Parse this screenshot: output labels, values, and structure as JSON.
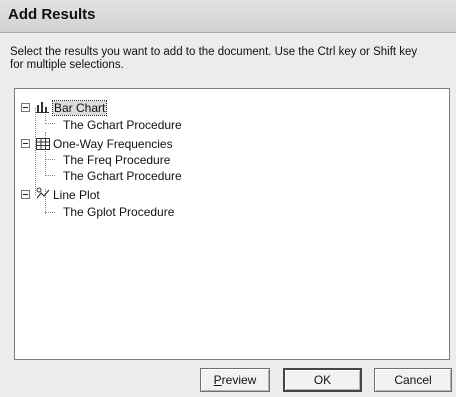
{
  "dialog": {
    "title": "Add Results",
    "instructions": "Select the results you want to add to the document.  Use the Ctrl key or Shift key\nfor multiple selections."
  },
  "tree": {
    "nodes": [
      {
        "label": "Bar Chart",
        "icon": "bar-chart-icon",
        "expanded": true,
        "selected": true,
        "children": [
          "The Gchart Procedure"
        ]
      },
      {
        "label": "One-Way Frequencies",
        "icon": "table-icon",
        "expanded": true,
        "selected": false,
        "children": [
          "The Freq Procedure",
          "The Gchart Procedure"
        ]
      },
      {
        "label": "Line Plot",
        "icon": "line-plot-icon",
        "expanded": true,
        "selected": false,
        "children": [
          "The Gplot Procedure"
        ]
      }
    ]
  },
  "buttons": {
    "preview_first": "P",
    "preview_rest": "review",
    "ok": "OK",
    "cancel": "Cancel"
  }
}
